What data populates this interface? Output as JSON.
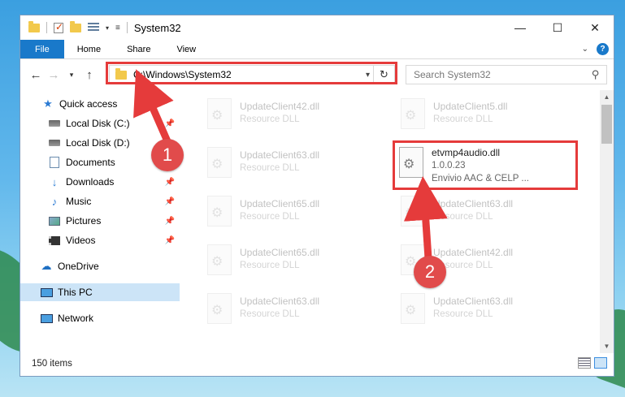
{
  "window": {
    "title": "System32",
    "controls": {
      "minimize": "—",
      "maximize": "☐",
      "close": "✕"
    }
  },
  "ribbon": {
    "tabs": [
      "File",
      "Home",
      "Share",
      "View"
    ],
    "help": "?"
  },
  "nav": {
    "address": "C:\\Windows\\System32",
    "search_placeholder": "Search System32"
  },
  "sidebar": {
    "quick_access": "Quick access",
    "items": [
      {
        "label": "Local Disk (C:)",
        "pinned": true
      },
      {
        "label": "Local Disk (D:)",
        "pinned": false
      },
      {
        "label": "Documents",
        "pinned": true
      },
      {
        "label": "Downloads",
        "pinned": true
      },
      {
        "label": "Music",
        "pinned": true
      },
      {
        "label": "Pictures",
        "pinned": true
      },
      {
        "label": "Videos",
        "pinned": true
      }
    ],
    "onedrive": "OneDrive",
    "this_pc": "This PC",
    "network": "Network"
  },
  "files": {
    "left_column": [
      {
        "name": "UpdateClient42.dll",
        "desc": "Resource DLL"
      },
      {
        "name": "UpdateClient63.dll",
        "desc": "Resource DLL"
      },
      {
        "name": "UpdateClient65.dll",
        "desc": "Resource DLL"
      },
      {
        "name": "UpdateClient65.dll",
        "desc": "Resource DLL"
      },
      {
        "name": "UpdateClient63.dll",
        "desc": "Resource DLL"
      }
    ],
    "right_column": [
      {
        "name": "UpdateClient5.dll",
        "desc": "Resource DLL"
      },
      {
        "name": "UpdateClient63.dll",
        "desc": "Resource DLL"
      },
      {
        "name": "UpdateClient42.dll",
        "desc": "Resource DLL"
      },
      {
        "name": "UpdateClient63.dll",
        "desc": "Resource DLL"
      }
    ],
    "highlighted": {
      "name": "etvmp4audio.dll",
      "version": "1.0.0.23",
      "desc": "Envivio AAC & CELP ..."
    }
  },
  "status": {
    "item_count": "150 items"
  },
  "annotations": {
    "step1": "1",
    "step2": "2",
    "color": "#e53b3b"
  }
}
